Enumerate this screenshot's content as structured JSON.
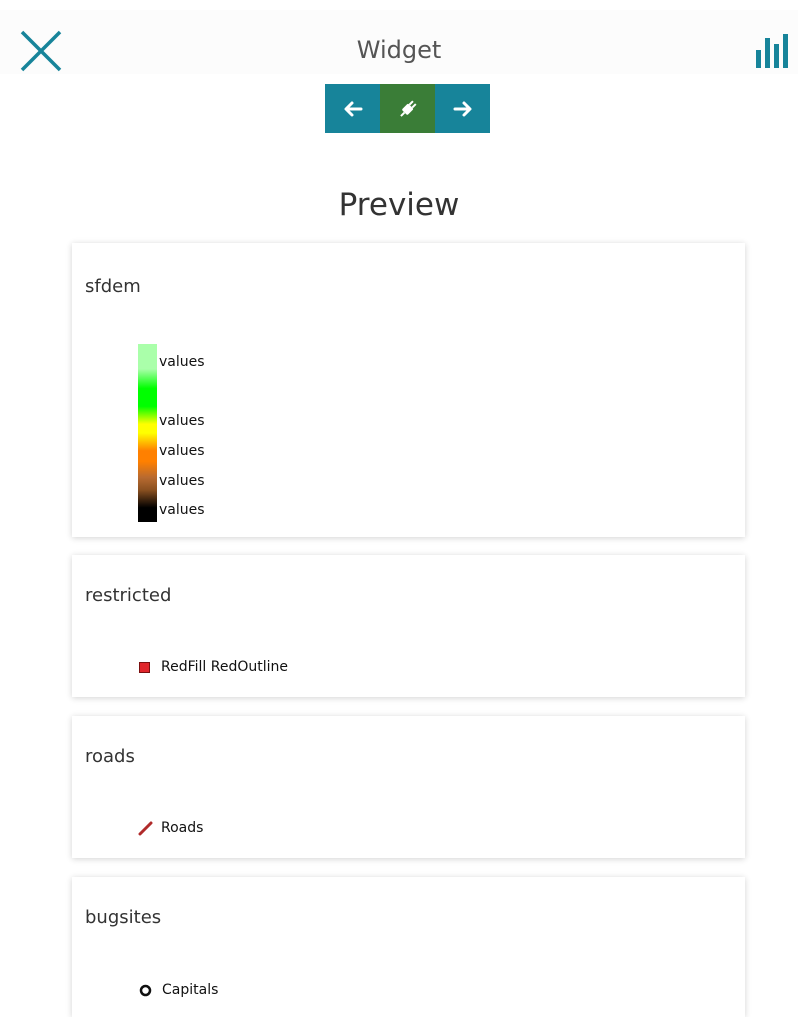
{
  "header": {
    "title": "Widget",
    "close_icon": "close-icon",
    "chart_icon": "bar-chart-icon"
  },
  "nav": {
    "back_icon": "arrow-left-icon",
    "center_icon": "plug-icon",
    "forward_icon": "arrow-right-icon"
  },
  "preview": {
    "title": "Preview",
    "layers": [
      {
        "name": "sfdem",
        "legend_type": "ramp",
        "labels": [
          "values",
          "values",
          "values",
          "values",
          "values"
        ]
      },
      {
        "name": "restricted",
        "legend_type": "polygon",
        "items": [
          {
            "label": "RedFill RedOutline",
            "icon": "red-square-icon",
            "color": "#e0262b"
          }
        ]
      },
      {
        "name": "roads",
        "legend_type": "line",
        "items": [
          {
            "label": "Roads",
            "icon": "line-icon",
            "color": "#b02a2a"
          }
        ]
      },
      {
        "name": "bugsites",
        "legend_type": "point",
        "items": [
          {
            "label": "Capitals",
            "icon": "circle-point-icon",
            "color": "#111111"
          }
        ]
      }
    ]
  },
  "colors": {
    "accent": "#17849a",
    "active": "#3a7d37"
  }
}
